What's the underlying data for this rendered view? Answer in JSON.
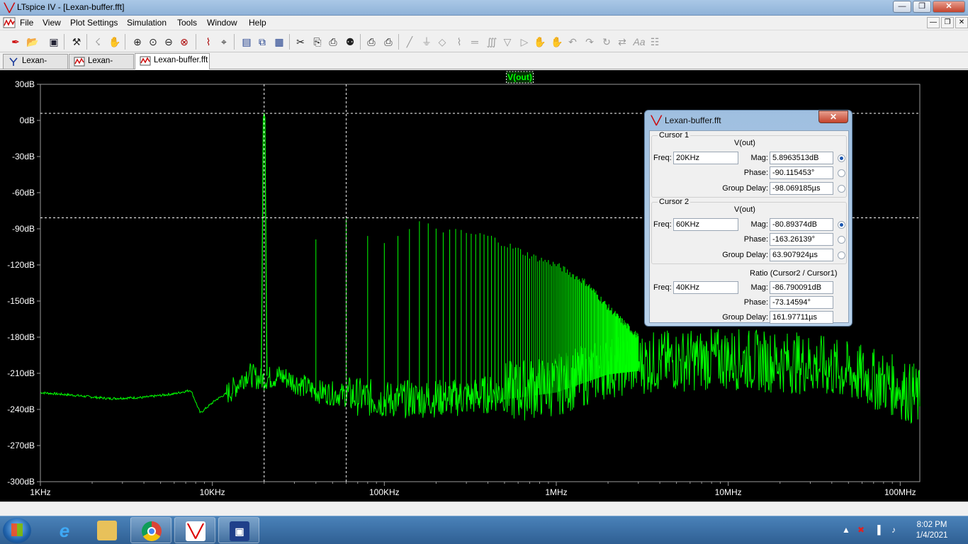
{
  "window": {
    "title": "LTspice IV - [Lexan-buffer.fft]",
    "minimize_label": "—",
    "maximize_label": "❐",
    "close_label": "✕"
  },
  "menu": {
    "items": [
      "File",
      "View",
      "Plot Settings",
      "Simulation",
      "Tools",
      "Window",
      "Help"
    ]
  },
  "toolbar": {
    "icons": [
      "new-schematic-icon",
      "open-icon",
      "save-icon",
      "control-panel-icon",
      "run-icon",
      "pan-icon",
      "zoom-in-icon",
      "zoom-area-icon",
      "zoom-out-icon",
      "zoom-cancel-icon",
      "autorange-icon",
      "pick-trace-icon",
      "tile-vertical-icon",
      "cascade-icon",
      "tile-icon",
      "cut-icon",
      "copy-icon",
      "paste-icon",
      "find-icon",
      "print-preview-icon",
      "print-icon",
      "wire-icon",
      "ground-icon",
      "label-net-icon",
      "resistor-icon",
      "capacitor-icon",
      "inductor-icon",
      "diode-icon",
      "component-icon",
      "move-icon",
      "drag-icon",
      "undo-icon",
      "redo-icon",
      "rotate-icon",
      "mirror-icon",
      "text-icon",
      "spice-directive-icon"
    ]
  },
  "tabs": [
    {
      "label": "Lexan-buffer",
      "icon": "schematic-icon"
    },
    {
      "label": "Lexan-buffer",
      "icon": "waveform-icon"
    },
    {
      "label": "Lexan-buffer.fft",
      "icon": "waveform-icon"
    }
  ],
  "plot": {
    "trace_label": "V(out)",
    "trace_color": "#00ff00",
    "background": "#000000",
    "cursor_color": "#ffffff"
  },
  "chart_data": {
    "type": "line",
    "title": "V(out)",
    "xscale": "log",
    "x_unit": "Hz",
    "xlim": [
      1000,
      130000000
    ],
    "ylim": [
      -300,
      30
    ],
    "x_tick_labels": [
      "1KHz",
      "10KHz",
      "100KHz",
      "1MHz",
      "10MHz",
      "100MHz"
    ],
    "x_tick_values": [
      1000,
      10000,
      100000,
      1000000,
      10000000,
      100000000
    ],
    "y_tick_labels": [
      "30dB",
      "0dB",
      "-30dB",
      "-60dB",
      "-90dB",
      "-120dB",
      "-150dB",
      "-180dB",
      "-210dB",
      "-240dB",
      "-270dB",
      "-300dB"
    ],
    "y_tick_values": [
      30,
      0,
      -30,
      -60,
      -90,
      -120,
      -150,
      -180,
      -210,
      -240,
      -270,
      -300
    ],
    "grid": false,
    "series": [
      {
        "name": "V(out)",
        "fundamental": {
          "freq": 20000,
          "mag": 5.9
        },
        "noise_floor_points": [
          [
            1000,
            -226
          ],
          [
            1500,
            -228
          ],
          [
            2500,
            -231
          ],
          [
            4000,
            -230
          ],
          [
            6000,
            -227
          ],
          [
            7500,
            -224
          ],
          [
            8500,
            -243
          ],
          [
            10500,
            -232
          ],
          [
            13000,
            -224
          ],
          [
            16000,
            -210
          ],
          [
            19000,
            -215
          ],
          [
            25000,
            -212
          ],
          [
            40000,
            -225
          ],
          [
            100000,
            -232
          ],
          [
            300000,
            -230
          ],
          [
            1000000,
            -220
          ],
          [
            2000000,
            -205
          ],
          [
            4000000,
            -200
          ],
          [
            10000000,
            -198
          ],
          [
            30000000,
            -202
          ],
          [
            60000000,
            -212
          ],
          [
            100000000,
            -222
          ],
          [
            130000000,
            -232
          ]
        ],
        "harmonics": [
          {
            "freq": 40000,
            "mag": -97
          },
          {
            "freq": 60000,
            "mag": -81
          },
          {
            "freq": 100000,
            "mag": -103
          },
          {
            "freq": 160000,
            "mag": -86
          },
          {
            "freq": 240000,
            "mag": -92
          },
          {
            "freq": 400000,
            "mag": -96
          },
          {
            "freq": 700000,
            "mag": -112
          },
          {
            "freq": 1000000,
            "mag": -120
          },
          {
            "freq": 1500000,
            "mag": -135
          },
          {
            "freq": 2000000,
            "mag": -155
          },
          {
            "freq": 3000000,
            "mag": -180
          }
        ],
        "spur": {
          "freq": 120000000,
          "mag": -202
        }
      }
    ],
    "cursors": [
      {
        "name": "Cursor 1",
        "x": 20000,
        "y": 5.9
      },
      {
        "name": "Cursor 2",
        "x": 60000,
        "y": -80.9
      }
    ]
  },
  "cursor_window": {
    "title": "Lexan-buffer.fft",
    "close_label": "✕",
    "cursor1": {
      "heading": "Cursor 1",
      "signal": "V(out)",
      "freq_label": "Freq:",
      "freq": "20KHz",
      "mag_label": "Mag:",
      "mag": "5.8963513dB",
      "phase_label": "Phase:",
      "phase": "-90.115453°",
      "gd_label": "Group Delay:",
      "gd": "-98.069185µs"
    },
    "cursor2": {
      "heading": "Cursor 2",
      "signal": "V(out)",
      "freq_label": "Freq:",
      "freq": "60KHz",
      "mag_label": "Mag:",
      "mag": "-80.89374dB",
      "phase_label": "Phase:",
      "phase": "-163.26139°",
      "gd_label": "Group Delay:",
      "gd": "63.907924µs"
    },
    "ratio": {
      "heading": "Ratio (Cursor2 / Cursor1)",
      "freq_label": "Freq:",
      "freq": "40KHz",
      "mag_label": "Mag:",
      "mag": "-86.790091dB",
      "phase_label": "Phase:",
      "phase": "-73.14594°",
      "gd_label": "Group Delay:",
      "gd": "161.97711µs"
    }
  },
  "taskbar": {
    "apps": [
      "internet-explorer-icon",
      "file-explorer-icon",
      "chrome-icon",
      "ltspice-icon",
      "save-disk-icon"
    ],
    "clock_time": "8:02 PM",
    "clock_date": "1/4/2021"
  }
}
